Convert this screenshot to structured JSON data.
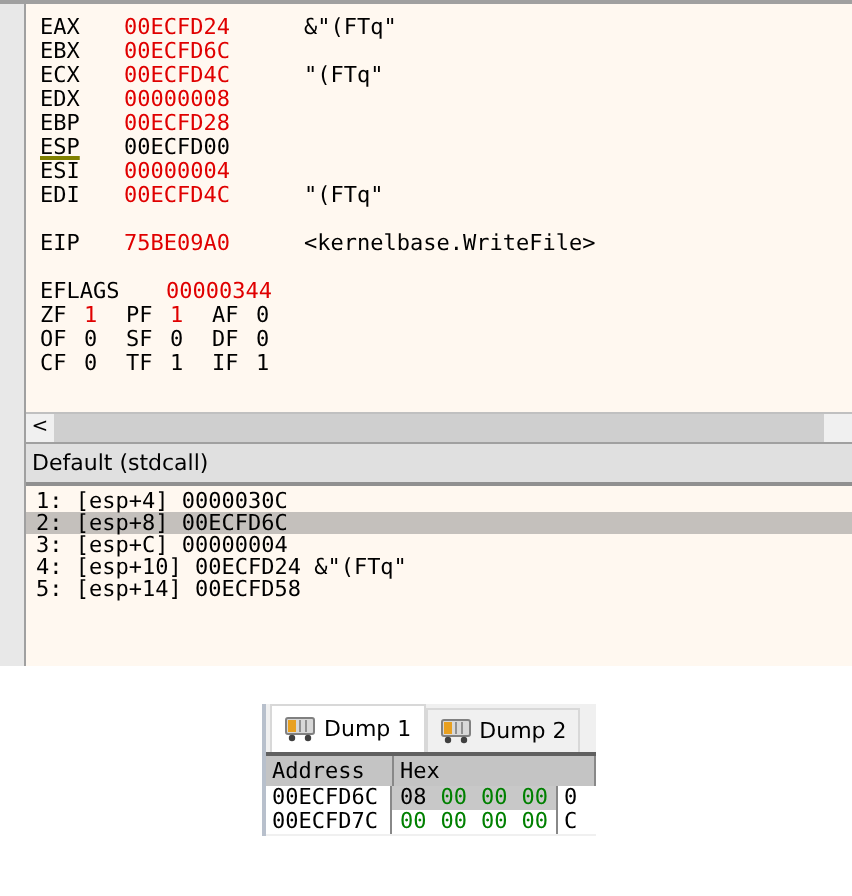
{
  "registers": [
    {
      "name": "EAX",
      "value": "00ECFD24",
      "changed": true,
      "comment": "&\"(FTq\"",
      "underlined": false
    },
    {
      "name": "EBX",
      "value": "00ECFD6C",
      "changed": true,
      "underlined": false
    },
    {
      "name": "ECX",
      "value": "00ECFD4C",
      "changed": true,
      "comment": "\"(FTq\"",
      "underlined": false
    },
    {
      "name": "EDX",
      "value": "00000008",
      "changed": true,
      "underlined": false
    },
    {
      "name": "EBP",
      "value": "00ECFD28",
      "changed": true,
      "underlined": false
    },
    {
      "name": "ESP",
      "value": "00ECFD00",
      "changed": false,
      "underlined": true
    },
    {
      "name": "ESI",
      "value": "00000004",
      "changed": true,
      "underlined": false
    },
    {
      "name": "EDI",
      "value": "00ECFD4C",
      "changed": true,
      "comment": "\"(FTq\"",
      "underlined": false
    }
  ],
  "eip": {
    "name": "EIP",
    "value": "75BE09A0",
    "changed": true,
    "comment": "<kernelbase.WriteFile>"
  },
  "eflags": {
    "name": "EFLAGS",
    "value": "00000344",
    "changed": true
  },
  "flags": [
    [
      {
        "name": "ZF",
        "value": "1",
        "changed": true
      },
      {
        "name": "PF",
        "value": "1",
        "changed": true
      },
      {
        "name": "AF",
        "value": "0",
        "changed": false
      }
    ],
    [
      {
        "name": "OF",
        "value": "0",
        "changed": false
      },
      {
        "name": "SF",
        "value": "0",
        "changed": false
      },
      {
        "name": "DF",
        "value": "0",
        "changed": false
      }
    ],
    [
      {
        "name": "CF",
        "value": "0",
        "changed": false
      },
      {
        "name": "TF",
        "value": "1",
        "changed": false
      },
      {
        "name": "IF",
        "value": "1",
        "changed": false
      }
    ]
  ],
  "scroll_left": "<",
  "call_panel": {
    "title": "Default (stdcall)",
    "rows": [
      {
        "index": "1:",
        "location": "[esp+4]",
        "value": "0000030C",
        "selected": false
      },
      {
        "index": "2:",
        "location": "[esp+8]",
        "value": "00ECFD6C",
        "selected": true
      },
      {
        "index": "3:",
        "location": "[esp+C]",
        "value": "00000004",
        "selected": false
      },
      {
        "index": "4:",
        "location": "[esp+10]",
        "value": "00ECFD24",
        "comment": "&\"(FTq\"",
        "selected": false
      },
      {
        "index": "5:",
        "location": "[esp+14]",
        "value": "00ECFD58",
        "selected": false
      }
    ]
  },
  "dump": {
    "tabs": [
      {
        "label": "Dump 1",
        "selected": true
      },
      {
        "label": "Dump 2",
        "selected": false
      }
    ],
    "columns": [
      "Address",
      "Hex"
    ],
    "rows": [
      {
        "address": "00ECFD6C",
        "bytes": [
          {
            "text": "08",
            "color": "#000000"
          },
          {
            "text": "00",
            "color": "#008000"
          },
          {
            "text": "00",
            "color": "#008000"
          },
          {
            "text": "00",
            "color": "#008000"
          }
        ],
        "next": "0",
        "selected": true
      },
      {
        "address": "00ECFD7C",
        "bytes": [
          {
            "text": "00",
            "color": "#008000"
          },
          {
            "text": "00",
            "color": "#008000"
          },
          {
            "text": "00",
            "color": "#008000"
          },
          {
            "text": "00",
            "color": "#008000"
          }
        ],
        "next": "C",
        "selected": false
      }
    ]
  }
}
